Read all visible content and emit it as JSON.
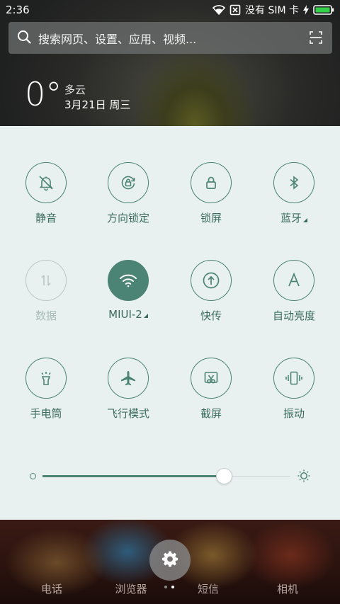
{
  "status_bar": {
    "time": "2:36",
    "carrier": "没有 SIM 卡",
    "icons": [
      "wifi-icon",
      "sim-disabled-icon",
      "charging-icon",
      "battery-icon"
    ]
  },
  "search": {
    "placeholder": "搜索网页、设置、应用、视频..."
  },
  "weather": {
    "temperature": "0°",
    "condition": "多云",
    "date": "3月21日 周三"
  },
  "quick_settings": {
    "accent_color": "#4b8374",
    "toggles": [
      {
        "label": "静音",
        "icon": "mute-bell-icon",
        "active": false,
        "enabled": true
      },
      {
        "label": "方向锁定",
        "icon": "rotation-lock-icon",
        "active": false,
        "enabled": true
      },
      {
        "label": "锁屏",
        "icon": "lock-icon",
        "active": false,
        "enabled": true
      },
      {
        "label": "蓝牙",
        "icon": "bluetooth-icon",
        "active": false,
        "enabled": true,
        "has_more": true
      },
      {
        "label": "数据",
        "icon": "data-arrows-icon",
        "active": false,
        "enabled": false
      },
      {
        "label": "MIUI-2",
        "icon": "wifi-icon",
        "active": true,
        "enabled": true,
        "has_more": true
      },
      {
        "label": "快传",
        "icon": "transfer-icon",
        "active": false,
        "enabled": true
      },
      {
        "label": "自动亮度",
        "icon": "auto-brightness-icon",
        "active": false,
        "enabled": true
      },
      {
        "label": "手电筒",
        "icon": "flashlight-icon",
        "active": false,
        "enabled": true
      },
      {
        "label": "飞行模式",
        "icon": "airplane-icon",
        "active": false,
        "enabled": true
      },
      {
        "label": "截屏",
        "icon": "screenshot-icon",
        "active": false,
        "enabled": true
      },
      {
        "label": "振动",
        "icon": "vibrate-icon",
        "active": false,
        "enabled": true
      }
    ],
    "brightness_level": 0.73
  },
  "dock": {
    "apps": [
      "电话",
      "浏览器",
      "短信",
      "相机"
    ],
    "settings_icon": "gear-icon",
    "page_count": 2,
    "current_page": 2
  }
}
